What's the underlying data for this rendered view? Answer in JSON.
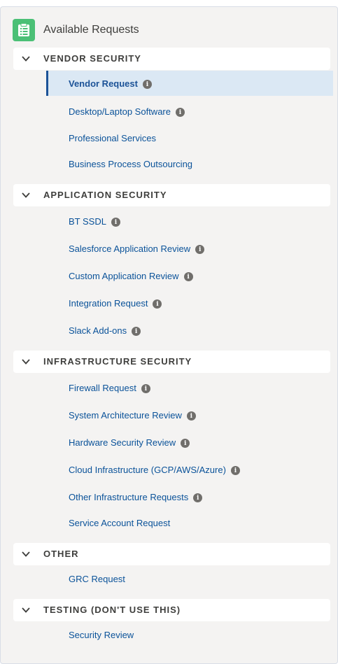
{
  "header": {
    "title": "Available Requests",
    "icon": "clipboard-list-icon",
    "icon_color": "#4bc076"
  },
  "accent_color": "#1b5297",
  "sections": [
    {
      "label": "VENDOR SECURITY",
      "expanded": true,
      "items": [
        {
          "label": "Vendor Request",
          "info": true,
          "active": true
        },
        {
          "label": "Desktop/Laptop Software",
          "info": true
        },
        {
          "label": "Professional Services",
          "info": false
        },
        {
          "label": "Business Process Outsourcing",
          "info": false
        }
      ]
    },
    {
      "label": "APPLICATION SECURITY",
      "expanded": true,
      "items": [
        {
          "label": "BT SSDL",
          "info": true
        },
        {
          "label": "Salesforce Application Review",
          "info": true
        },
        {
          "label": "Custom Application Review",
          "info": true
        },
        {
          "label": "Integration Request",
          "info": true
        },
        {
          "label": "Slack Add-ons",
          "info": true
        }
      ]
    },
    {
      "label": "INFRASTRUCTURE SECURITY",
      "expanded": true,
      "items": [
        {
          "label": "Firewall Request",
          "info": true
        },
        {
          "label": "System Architecture Review",
          "info": true
        },
        {
          "label": "Hardware Security Review",
          "info": true
        },
        {
          "label": "Cloud Infrastructure (GCP/AWS/Azure)",
          "info": true
        },
        {
          "label": "Other Infrastructure Requests",
          "info": true
        },
        {
          "label": "Service Account Request",
          "info": false
        }
      ]
    },
    {
      "label": "OTHER",
      "expanded": true,
      "items": [
        {
          "label": "GRC Request",
          "info": false
        }
      ]
    },
    {
      "label": "TESTING (DON'T USE THIS)",
      "expanded": true,
      "items": [
        {
          "label": "Security Review",
          "info": false
        }
      ]
    }
  ]
}
